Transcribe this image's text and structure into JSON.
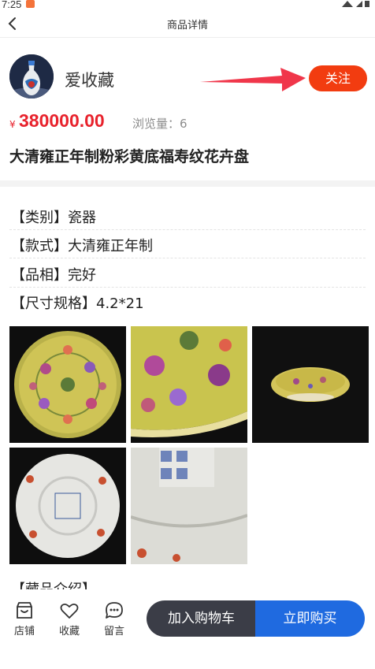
{
  "status_bar": {
    "time": "7:25"
  },
  "header": {
    "title": "商品详情"
  },
  "seller": {
    "name": "爱收藏",
    "follow_label": "关注"
  },
  "product": {
    "currency_symbol": "¥",
    "price": "380000.00",
    "views_label": "浏览量：6",
    "title": "大清雍正年制粉彩黄底福寿纹花卉盘"
  },
  "specs": [
    {
      "label": "【类别】瓷器"
    },
    {
      "label": "【款式】大清雍正年制"
    },
    {
      "label": "【品相】完好"
    },
    {
      "label": "【尺寸规格】4.2*21"
    }
  ],
  "gallery": {
    "photos": [
      {
        "icon": "plate-top-view-photo"
      },
      {
        "icon": "plate-closeup-photo"
      },
      {
        "icon": "plate-side-view-photo"
      },
      {
        "icon": "plate-underside-photo"
      },
      {
        "icon": "reign-mark-closeup-photo"
      }
    ]
  },
  "intro": {
    "label": "【藏品介绍】"
  },
  "bottom_bar": {
    "shop_label": "店铺",
    "favorite_label": "收藏",
    "message_label": "留言",
    "cart_label": "加入购物车",
    "buy_label": "立即购买"
  },
  "colors": {
    "accent_red": "#f23c10",
    "price_red": "#e8222c",
    "buy_blue": "#1f6ae0",
    "cart_dark": "#3b3d47"
  }
}
